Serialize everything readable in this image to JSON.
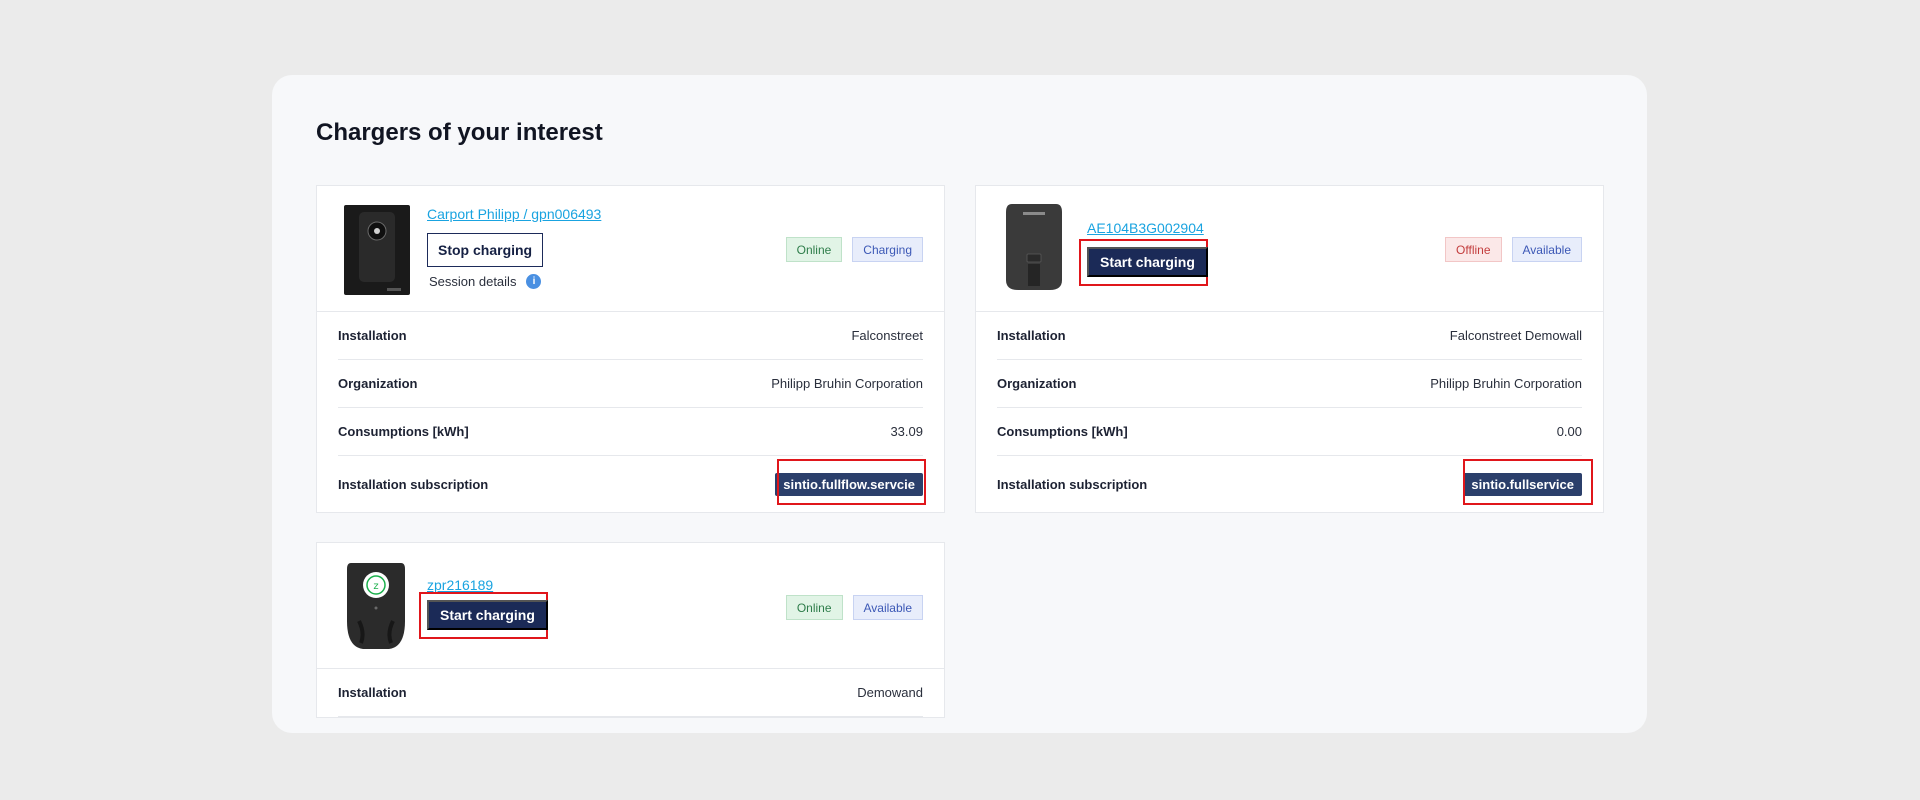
{
  "page": {
    "title": "Chargers of your interest"
  },
  "chargers": [
    {
      "name": "Carport Philipp / gpn006493",
      "action_label": "Stop charging",
      "session_label": "Session details",
      "status_badges": [
        "Online",
        "Charging"
      ],
      "rows": [
        {
          "label": "Installation",
          "value": "Falconstreet"
        },
        {
          "label": "Organization",
          "value": "Philipp Bruhin Corporation"
        },
        {
          "label": "Consumptions [kWh]",
          "value": "33.09"
        },
        {
          "label": "Installation subscription",
          "value": "sintio.fullflow.servcie"
        }
      ]
    },
    {
      "name": "AE104B3G002904",
      "action_label": "Start charging",
      "status_badges": [
        "Offline",
        "Available"
      ],
      "rows": [
        {
          "label": "Installation",
          "value": "Falconstreet Demowall"
        },
        {
          "label": "Organization",
          "value": "Philipp Bruhin Corporation"
        },
        {
          "label": "Consumptions [kWh]",
          "value": "0.00"
        },
        {
          "label": "Installation subscription",
          "value": "sintio.fullservice"
        }
      ]
    },
    {
      "name": "zpr216189",
      "action_label": "Start charging",
      "status_badges": [
        "Online",
        "Available"
      ],
      "rows": [
        {
          "label": "Installation",
          "value": "Demowand"
        }
      ]
    }
  ],
  "icons": {
    "info": "info-icon",
    "charger_1": "wallbox-charger-icon",
    "charger_2": "elecq-charger-icon",
    "charger_3": "zappi-charger-icon"
  },
  "colors": {
    "primary": "#1b2a57",
    "link": "#19a3e0",
    "highlight": "#e0161b",
    "online": "#2e7d4a",
    "offline": "#c33d3d"
  }
}
